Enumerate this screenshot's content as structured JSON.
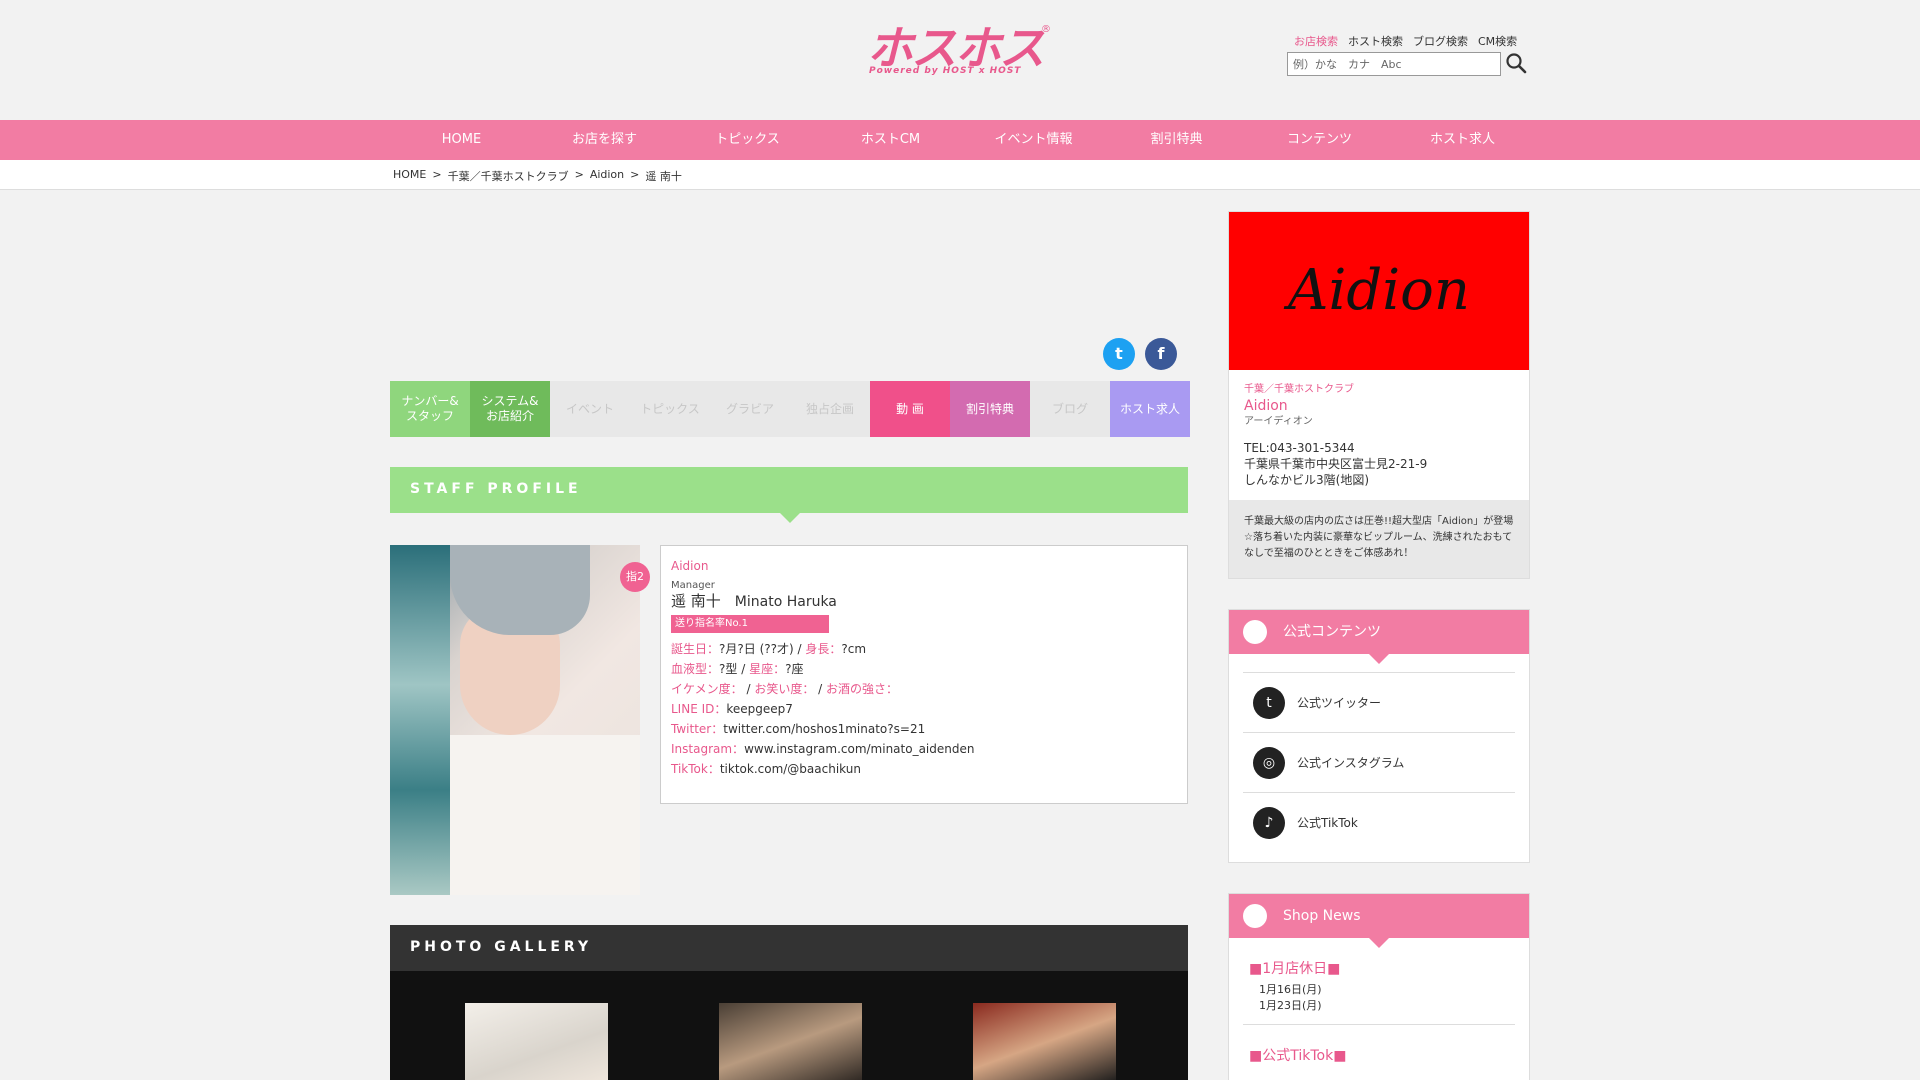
{
  "header": {
    "logo_text": "ホスホス",
    "logo_sub": "Powered by HOST x HOST",
    "search_tabs": [
      "お店検索",
      "ホスト検索",
      "ブログ検索",
      "CM検索"
    ],
    "search_placeholder": "例）かな　カナ　Abc"
  },
  "nav": [
    "HOME",
    "お店を探す",
    "トピックス",
    "ホストCM",
    "イベント情報",
    "割引特典",
    "コンテンツ",
    "ホスト求人"
  ],
  "breadcrumb": [
    "HOME",
    "千葉／千葉ホストクラブ",
    "Aidion",
    "遥 南十"
  ],
  "tabs": [
    {
      "label": "ナンバー&\nスタッフ",
      "color": "#8fd67d",
      "disabled": false
    },
    {
      "label": "システム&\nお店紹介",
      "color": "#6fbb5b",
      "disabled": false
    },
    {
      "label": "イベント",
      "disabled": true
    },
    {
      "label": "トピックス",
      "disabled": true
    },
    {
      "label": "グラビア",
      "disabled": true
    },
    {
      "label": "独占企画",
      "disabled": true
    },
    {
      "label": "動 画",
      "color": "#f0508a",
      "disabled": false
    },
    {
      "label": "割引特典",
      "color": "#d36bb0",
      "disabled": false
    },
    {
      "label": "ブログ",
      "disabled": true
    },
    {
      "label": "ホスト求人",
      "color": "#a99af2",
      "disabled": false
    }
  ],
  "staff_profile_title": "STAFF PROFILE",
  "profile": {
    "badge": "指2",
    "shop": "Aidion",
    "role": "Manager",
    "name_jp": "遥 南十",
    "name_en": "Minato Haruka",
    "rank": "送り指名率No.1",
    "birthday_label": "誕生日：",
    "birthday": "?月?日 (??才)",
    "height_label": "身長：",
    "height": "?cm",
    "blood_label": "血液型：",
    "blood": "?型",
    "sign_label": "星座：",
    "sign": "?座",
    "looks_label": "イケメン度：",
    "fun_label": "お笑い度：",
    "drink_label": "お酒の強さ：",
    "line_label": "LINE ID：",
    "line": "keepgeep7",
    "twitter_label": "Twitter：",
    "twitter": "twitter.com/hoshos1minato?s=21",
    "instagram_label": "Instagram：",
    "instagram": "www.instagram.com/minato_aidenden",
    "tiktok_label": "TikTok：",
    "tiktok": "tiktok.com/@baachikun"
  },
  "photo_gallery_title": "PHOTO GALLERY",
  "sidebar": {
    "shop_logo": "Aidion",
    "category": "千葉／千葉ホストクラブ",
    "shop_name": "Aidion",
    "shop_kana": "アーイディオン",
    "tel": "TEL:043-301-5344",
    "address": "千葉県千葉市中央区富士見2-21-9",
    "building": "しんなかビル3階",
    "map_link": "(地図)",
    "description": "千葉最大級の店内の広さは圧巻!!超大型店「Aidion」が登場☆落ち着いた内装に豪華なビップルーム、洗練されたおもてなしで至福のひとときをご体感あれ！",
    "official_title": "公式コンテンツ",
    "official_links": [
      "公式ツイッター",
      "公式インスタグラム",
      "公式TikTok"
    ],
    "news_title": "Shop News",
    "news": [
      {
        "title": "■1月店休日■",
        "lines": [
          "1月16日(月)",
          "1月23日(月)"
        ]
      },
      {
        "title": "■公式TikTok■",
        "lines": []
      }
    ]
  }
}
